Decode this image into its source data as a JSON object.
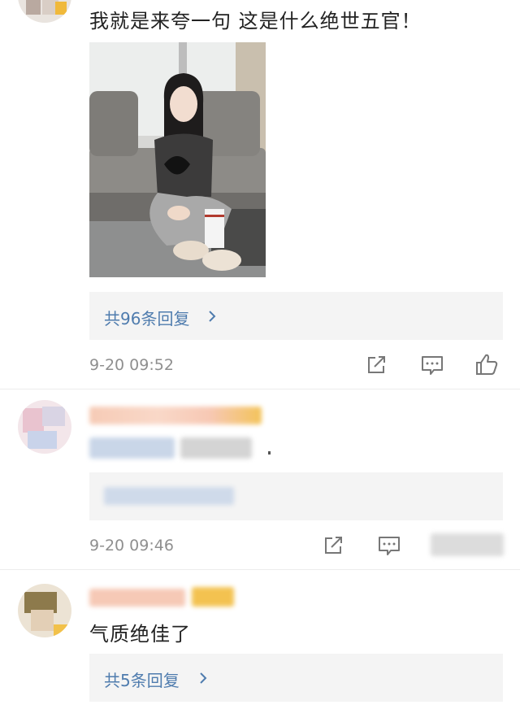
{
  "comments": [
    {
      "text": "我就是来夸一句 这是什么绝世五官！",
      "replies_label": "共96条回复",
      "timestamp": "9-20 09:52"
    },
    {
      "timestamp": "9-20 09:46"
    },
    {
      "text": "气质绝佳了",
      "replies_label": "共5条回复"
    }
  ],
  "icons": {
    "share": "share-icon",
    "comment": "comment-icon",
    "like": "thumbs-up-icon",
    "chevron": "chevron-right-icon"
  },
  "colors": {
    "link": "#4f7cae",
    "timestamp": "#8f8f8f",
    "reply_box": "#f4f4f4"
  }
}
